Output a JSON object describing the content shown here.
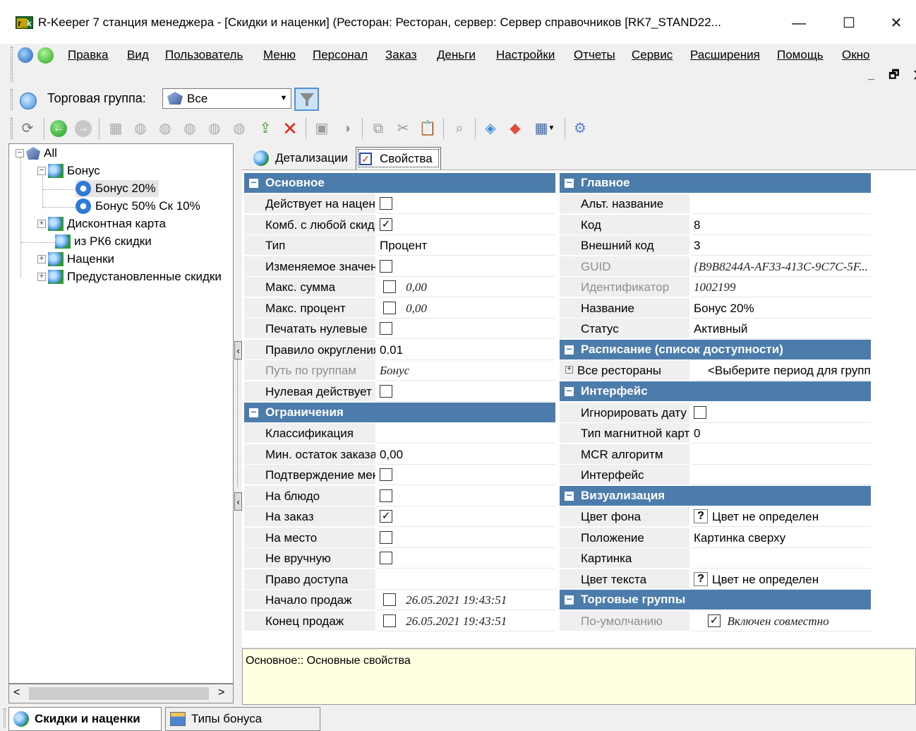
{
  "window": {
    "title": "R-Keeper 7 станция менеджера - [Скидки и наценки] (Ресторан: Ресторан, сервер: Сервер справочников [RK7_STAND22...",
    "icon_text_left": "r_",
    "icon_text_right": "k",
    "minimize": "—",
    "maximize": "☐",
    "close": "✕"
  },
  "menu": [
    "Правка",
    "Вид",
    "Пользователь",
    "Меню",
    "Персонал",
    "Заказ",
    "Деньги",
    "Настройки",
    "Отчеты",
    "Сервис",
    "Расширения",
    "Помощь",
    "Окно"
  ],
  "mdi_controls": "_ 🗗 ✕",
  "group_bar": {
    "label": "Торговая группа:",
    "selected": "Все"
  },
  "tree": {
    "nodes": [
      {
        "label": "All"
      },
      {
        "label": "Бонус"
      },
      {
        "label": "Бонус 20%"
      },
      {
        "label": "Бонус 50% Ск 10%"
      },
      {
        "label": "Дисконтная карта"
      },
      {
        "label": "из РК6 скидки"
      },
      {
        "label": "Наценки"
      },
      {
        "label": "Предустановленные скидки"
      }
    ]
  },
  "tabs": {
    "details": "Детализации",
    "properties": "Свойства"
  },
  "left_grid": {
    "sec_basic": "Основное",
    "sec_limits": "Ограничения",
    "rows": [
      {
        "name": "Действует на наценки",
        "check": "",
        "text": ""
      },
      {
        "name": "Комб. с любой скидкой",
        "check": "✓",
        "text": ""
      },
      {
        "name": "Тип",
        "text": "Процент"
      },
      {
        "name": "Изменяемое значение",
        "check": "",
        "text": ""
      },
      {
        "name": "Макс. сумма",
        "check": "",
        "text": "0,00"
      },
      {
        "name": "Макс. процент",
        "check": "",
        "text": "0,00"
      },
      {
        "name": "Печатать нулевые",
        "check": "",
        "text": ""
      },
      {
        "name": "Правило округления",
        "text": "0.01"
      },
      {
        "name": "Путь по группам",
        "text": "Бонус"
      },
      {
        "name": "Нулевая действует",
        "check": "",
        "text": ""
      },
      {
        "name": "Классификация",
        "text": ""
      },
      {
        "name": "Мин. остаток заказа",
        "text": "0,00"
      },
      {
        "name": "Подтверждение менеджером",
        "check": "",
        "text": ""
      },
      {
        "name": "На блюдо",
        "check": "",
        "text": ""
      },
      {
        "name": "На заказ",
        "check": "✓",
        "text": ""
      },
      {
        "name": "На место",
        "check": "",
        "text": ""
      },
      {
        "name": "Не вручную",
        "check": "",
        "text": ""
      },
      {
        "name": "Право доступа",
        "text": ""
      },
      {
        "name": "Начало продаж",
        "check": "",
        "text": "26.05.2021 19:43:51"
      },
      {
        "name": "Конец продаж",
        "check": "",
        "text": "26.05.2021 19:43:51"
      }
    ]
  },
  "right_grid": {
    "sec_main": "Главное",
    "sec_schedule": "Расписание (список доступности)",
    "sec_interface": "Интерфейс",
    "sec_visual": "Визуализация",
    "sec_trade": "Торговые группы",
    "rows": [
      {
        "name": "Альт. название",
        "text": ""
      },
      {
        "name": "Код",
        "text": "8"
      },
      {
        "name": "Внешний код",
        "text": "3"
      },
      {
        "name": "GUID",
        "text": "{B9B8244A-AF33-413C-9C7C-5F..."
      },
      {
        "name": "Идентификатор",
        "text": "1002199"
      },
      {
        "name": "Название",
        "text": "Бонус 20%"
      },
      {
        "name": "Статус",
        "text": "Активный"
      },
      {
        "name": "Все рестораны",
        "text": "<Выберите период для группы>"
      },
      {
        "name": "Игнорировать дату",
        "check": "",
        "text": ""
      },
      {
        "name": "Тип магнитной карты",
        "text": "0"
      },
      {
        "name": "MCR алгоритм",
        "text": ""
      },
      {
        "name": "Интерфейс",
        "text": ""
      },
      {
        "name": "Цвет фона",
        "q": "?",
        "text": "Цвет не определен"
      },
      {
        "name": "Положение",
        "text": "Картинка сверху"
      },
      {
        "name": "Картинка",
        "text": ""
      },
      {
        "name": "Цвет текста",
        "q": "?",
        "text": "Цвет не определен"
      },
      {
        "name": "По-умолчанию",
        "check": "✓",
        "text": "Включен совместно"
      }
    ]
  },
  "description": "Основное:: Основные свойства",
  "bottom_tabs": [
    "Скидки и наценки",
    "Типы бонуса"
  ],
  "colors": {
    "section": "#4c7cab",
    "desc_bg": "#ffffe1",
    "name_bg": "#efefef"
  }
}
